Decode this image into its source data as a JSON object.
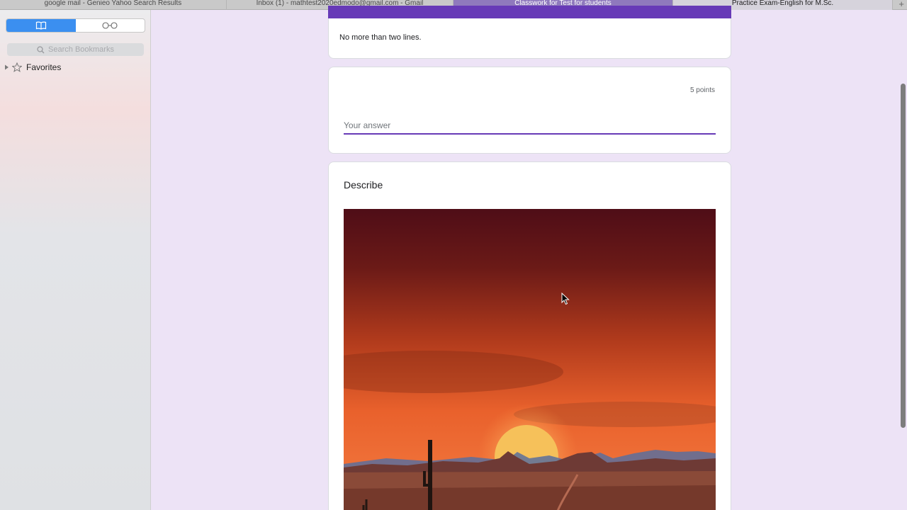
{
  "tabs": [
    {
      "label": "google mail - Genieo Yahoo Search Results"
    },
    {
      "label": "Inbox (1) - mathtest2020edmodo@gmail.com - Gmail"
    },
    {
      "label": "Classwork for Test for students"
    },
    {
      "label": "Practice Exam-English for M.Sc."
    }
  ],
  "new_tab_label": "+",
  "sidebar": {
    "bookmarks_icon": "book-icon",
    "reading_list_icon": "glasses-icon",
    "search_placeholder": "Search Bookmarks",
    "favorites_label": "Favorites"
  },
  "form": {
    "accent_color": "#673ab7",
    "section_description": "No more than two lines.",
    "question_points": "5 points",
    "answer_placeholder": "Your answer",
    "describe_title": "Describe"
  }
}
